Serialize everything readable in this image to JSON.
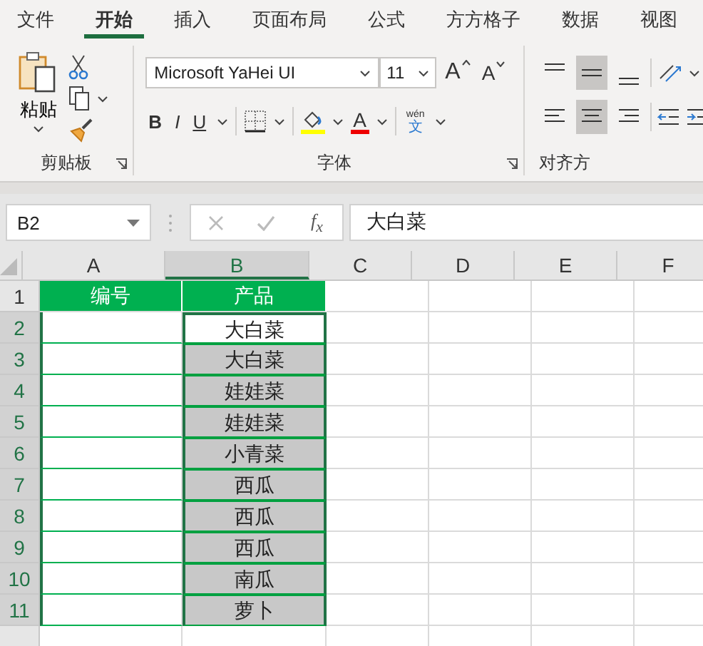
{
  "menu_tabs": [
    {
      "label": "文件",
      "selected": false
    },
    {
      "label": "开始",
      "selected": true
    },
    {
      "label": "插入",
      "selected": false
    },
    {
      "label": "页面布局",
      "selected": false
    },
    {
      "label": "公式",
      "selected": false
    },
    {
      "label": "方方格子",
      "selected": false
    },
    {
      "label": "数据",
      "selected": false
    },
    {
      "label": "视图",
      "selected": false
    }
  ],
  "ribbon": {
    "clipboard": {
      "paste_label": "粘贴",
      "group_label": "剪贴板"
    },
    "font": {
      "font_name": "Microsoft YaHei UI",
      "font_size": "11",
      "grow_label": "A",
      "shrink_label": "A",
      "bold_label": "B",
      "italic_label": "I",
      "underline_label": "U",
      "font_color_label": "A",
      "phonetic_top": "wén",
      "phonetic_char": "文",
      "group_label": "字体"
    },
    "alignment": {
      "vertical": [
        {
          "selected": false
        },
        {
          "selected": true
        },
        {
          "selected": false
        }
      ],
      "horizontal": [
        {
          "selected": false
        },
        {
          "selected": true
        },
        {
          "selected": false
        }
      ],
      "group_label": "对齐方"
    }
  },
  "formula_bar": {
    "name_box": "B2",
    "fx_label": "f$_{x}$",
    "value": "大白菜"
  },
  "columns": [
    {
      "label": "A",
      "selected": false
    },
    {
      "label": "B",
      "selected": true
    },
    {
      "label": "C",
      "selected": false
    },
    {
      "label": "D",
      "selected": false
    },
    {
      "label": "E",
      "selected": false
    },
    {
      "label": "F",
      "selected": false
    }
  ],
  "rows": [
    {
      "label": "1",
      "kind": "header",
      "selected": false,
      "cells": [
        {
          "text": "编号",
          "selected": false
        },
        {
          "text": "产品",
          "selected": false
        }
      ]
    },
    {
      "label": "2",
      "kind": "data",
      "selected": true,
      "cells": [
        {
          "selected": false
        },
        {
          "text": "大白菜",
          "selected": true,
          "active": true
        }
      ]
    },
    {
      "label": "3",
      "kind": "data",
      "selected": true,
      "cells": [
        {
          "selected": false
        },
        {
          "text": "大白菜",
          "selected": true
        }
      ]
    },
    {
      "label": "4",
      "kind": "data",
      "selected": true,
      "cells": [
        {
          "selected": false
        },
        {
          "text": "娃娃菜",
          "selected": true
        }
      ]
    },
    {
      "label": "5",
      "kind": "data",
      "selected": true,
      "cells": [
        {
          "selected": false
        },
        {
          "text": "娃娃菜",
          "selected": true
        }
      ]
    },
    {
      "label": "6",
      "kind": "data",
      "selected": true,
      "cells": [
        {
          "selected": false
        },
        {
          "text": "小青菜",
          "selected": true
        }
      ]
    },
    {
      "label": "7",
      "kind": "data",
      "selected": true,
      "cells": [
        {
          "selected": false
        },
        {
          "text": "西瓜",
          "selected": true
        }
      ]
    },
    {
      "label": "8",
      "kind": "data",
      "selected": true,
      "cells": [
        {
          "selected": false
        },
        {
          "text": "西瓜",
          "selected": true
        }
      ]
    },
    {
      "label": "9",
      "kind": "data",
      "selected": true,
      "cells": [
        {
          "selected": false
        },
        {
          "text": "西瓜",
          "selected": true
        }
      ]
    },
    {
      "label": "10",
      "kind": "data",
      "selected": true,
      "cells": [
        {
          "selected": false
        },
        {
          "text": "南瓜",
          "selected": true
        }
      ]
    },
    {
      "label": "11",
      "kind": "data",
      "selected": true,
      "cells": [
        {
          "selected": false
        },
        {
          "text": "萝卜",
          "selected": true
        }
      ]
    }
  ]
}
